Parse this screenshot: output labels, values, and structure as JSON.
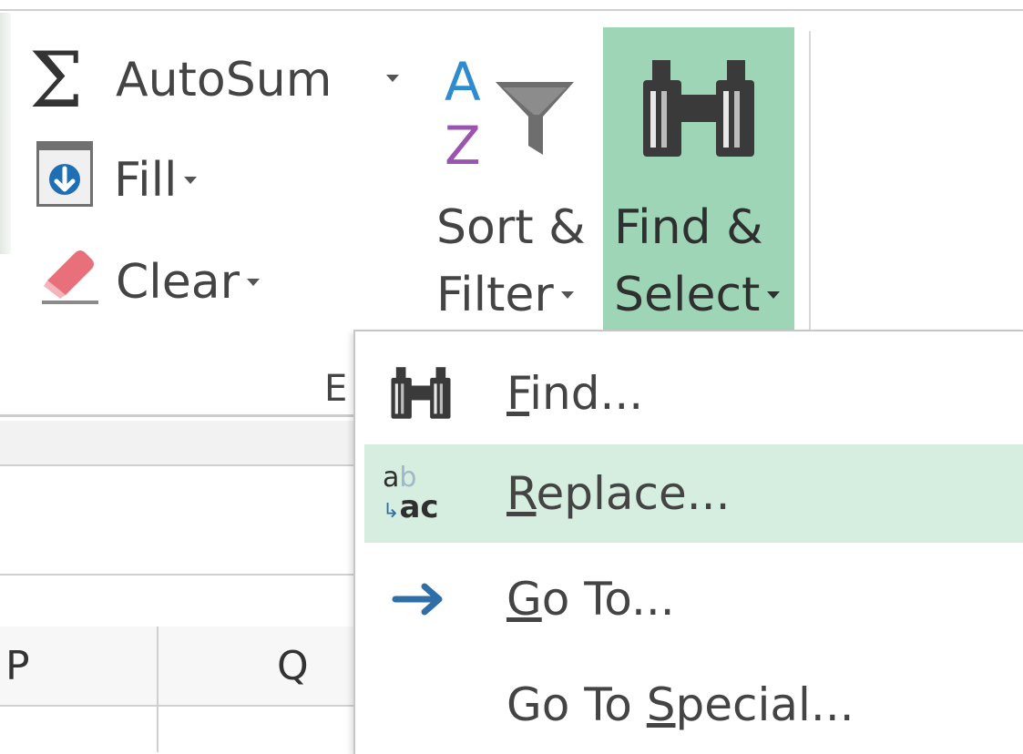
{
  "ribbon": {
    "autosum_label": "AutoSum",
    "fill_label": "Fill",
    "clear_label": "Clear",
    "sort_filter": {
      "line1": "Sort &",
      "line2": "Filter"
    },
    "find_select": {
      "line1": "Find &",
      "line2": "Select"
    },
    "group_label": "E"
  },
  "sheet": {
    "columns": [
      "P",
      "Q"
    ]
  },
  "menu": {
    "items": [
      {
        "name": "find",
        "hotkey": "F",
        "rest": "ind...",
        "icon": "binoculars-icon"
      },
      {
        "name": "replace",
        "hotkey": "R",
        "rest": "eplace...",
        "icon": "replace-abc-icon"
      },
      {
        "name": "goto",
        "hotkey": "G",
        "rest": "o To...",
        "icon": "arrow-right-icon"
      },
      {
        "name": "goto-special",
        "pre": "Go To ",
        "hotkey": "S",
        "rest": "pecial...",
        "icon": ""
      }
    ],
    "hover_index": 1
  },
  "colors": {
    "find_select_active_bg": "#9fd5b7",
    "menu_hover_bg": "#d5eedf",
    "arrow_blue": "#2f6ea6",
    "sort_az_blue": "#2e8bd0",
    "sort_az_purple": "#9a55b0",
    "eraser_pink": "#e8707a"
  }
}
